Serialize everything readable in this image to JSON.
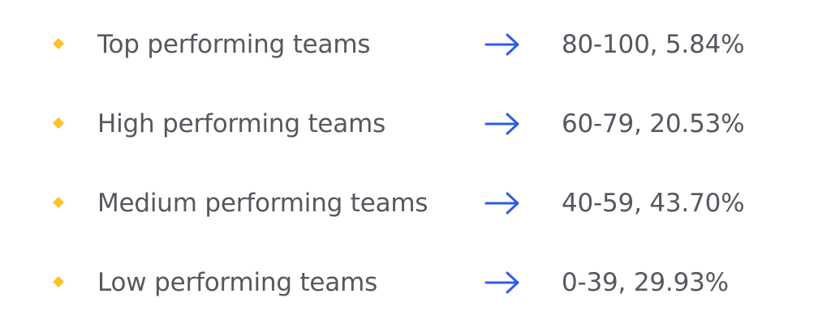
{
  "colors": {
    "bullet": "#F9C22E",
    "arrow": "#2F5BE8",
    "text": "#55585E",
    "background": "#FFFFFF"
  },
  "icons": {
    "bullet": "diamond-bullet-icon",
    "arrow": "arrow-right-icon"
  },
  "items": [
    {
      "label": "Top performing teams",
      "value": "80-100, 5.84%"
    },
    {
      "label": "High performing teams",
      "value": "60-79, 20.53%"
    },
    {
      "label": "Medium performing teams",
      "value": "40-59, 43.70%"
    },
    {
      "label": "Low performing teams",
      "value": "0-39, 29.93%"
    }
  ]
}
